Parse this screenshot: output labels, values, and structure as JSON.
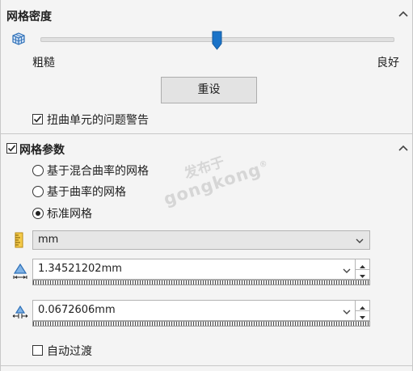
{
  "mesh_density": {
    "title": "网格密度",
    "slider_level": 0.5,
    "left_label": "粗糙",
    "right_label": "良好",
    "reset_label": "重设",
    "warn_checkbox_label": "扭曲单元的问题警告",
    "warn_checked": true
  },
  "mesh_params": {
    "title": "网格参数",
    "title_checked": true,
    "radio_options": [
      {
        "label": "基于混合曲率的网格",
        "selected": false
      },
      {
        "label": "基于曲率的网格",
        "selected": false
      },
      {
        "label": "标准网格",
        "selected": true
      }
    ],
    "unit_select": "mm",
    "global_size": "1.34521202mm",
    "tolerance": "0.0672606mm",
    "auto_transition_label": "自动过渡",
    "auto_transition_checked": false
  },
  "watermark": {
    "line1": "发布于",
    "line2": "gongkong",
    "mark": "®"
  },
  "icons": {
    "mesh_density": "mesh-cube-icon",
    "unit": "ruler-icon",
    "global_size": "element-size-icon",
    "tolerance": "tolerance-icon",
    "collapse": "chevron-up-icon",
    "dropdown": "chevron-down-icon"
  },
  "colors": {
    "accent": "#1a73c8",
    "icon_blue": "#2d6fb7",
    "ruler_yellow": "#e9b22a"
  }
}
